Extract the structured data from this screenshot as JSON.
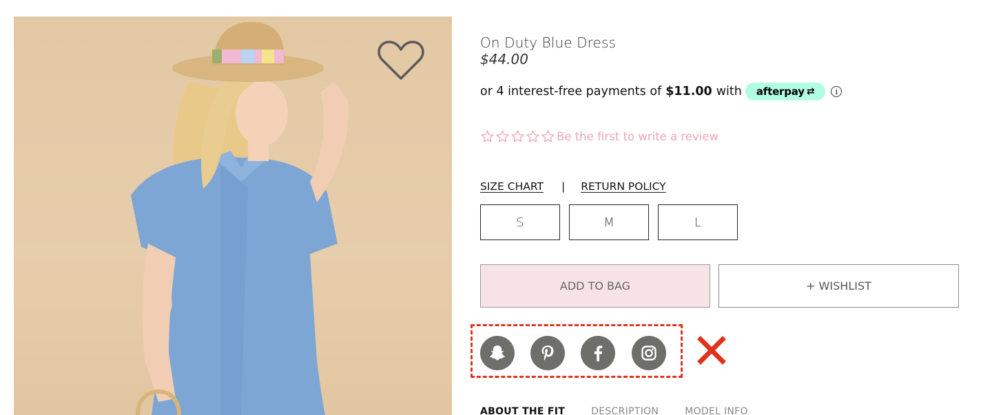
{
  "product": {
    "title": "On Duty Blue Dress",
    "price": "$44.00"
  },
  "afterpay": {
    "prefix": "or 4 interest-free payments of",
    "amount": "$11.00",
    "suffix": "with",
    "brand": "afterpay",
    "info_icon": "info-icon"
  },
  "reviews": {
    "star_count": 5,
    "rating": 0,
    "text": "Be the first to write a review",
    "color": "#f0a6b4"
  },
  "links": {
    "size_chart": "SIZE CHART",
    "separator": "|",
    "return_policy": "RETURN POLICY"
  },
  "sizes": [
    "S",
    "M",
    "L"
  ],
  "actions": {
    "add_to_bag": "ADD TO BAG",
    "wishlist": "+ WISHLIST"
  },
  "social": [
    {
      "name": "snapchat-icon"
    },
    {
      "name": "pinterest-icon"
    },
    {
      "name": "facebook-icon"
    },
    {
      "name": "instagram-icon"
    }
  ],
  "tabs": [
    "ABOUT THE FIT",
    "DESCRIPTION",
    "MODEL INFO"
  ],
  "colors": {
    "afterpay_badge": "#b2fce4",
    "add_to_bag_bg": "#f7e3e5",
    "social_icon_bg": "#6e6e6b",
    "annotation_red": "#e0331d"
  },
  "icons": {
    "favorite": "heart-icon",
    "annotation": "red-x-icon"
  }
}
